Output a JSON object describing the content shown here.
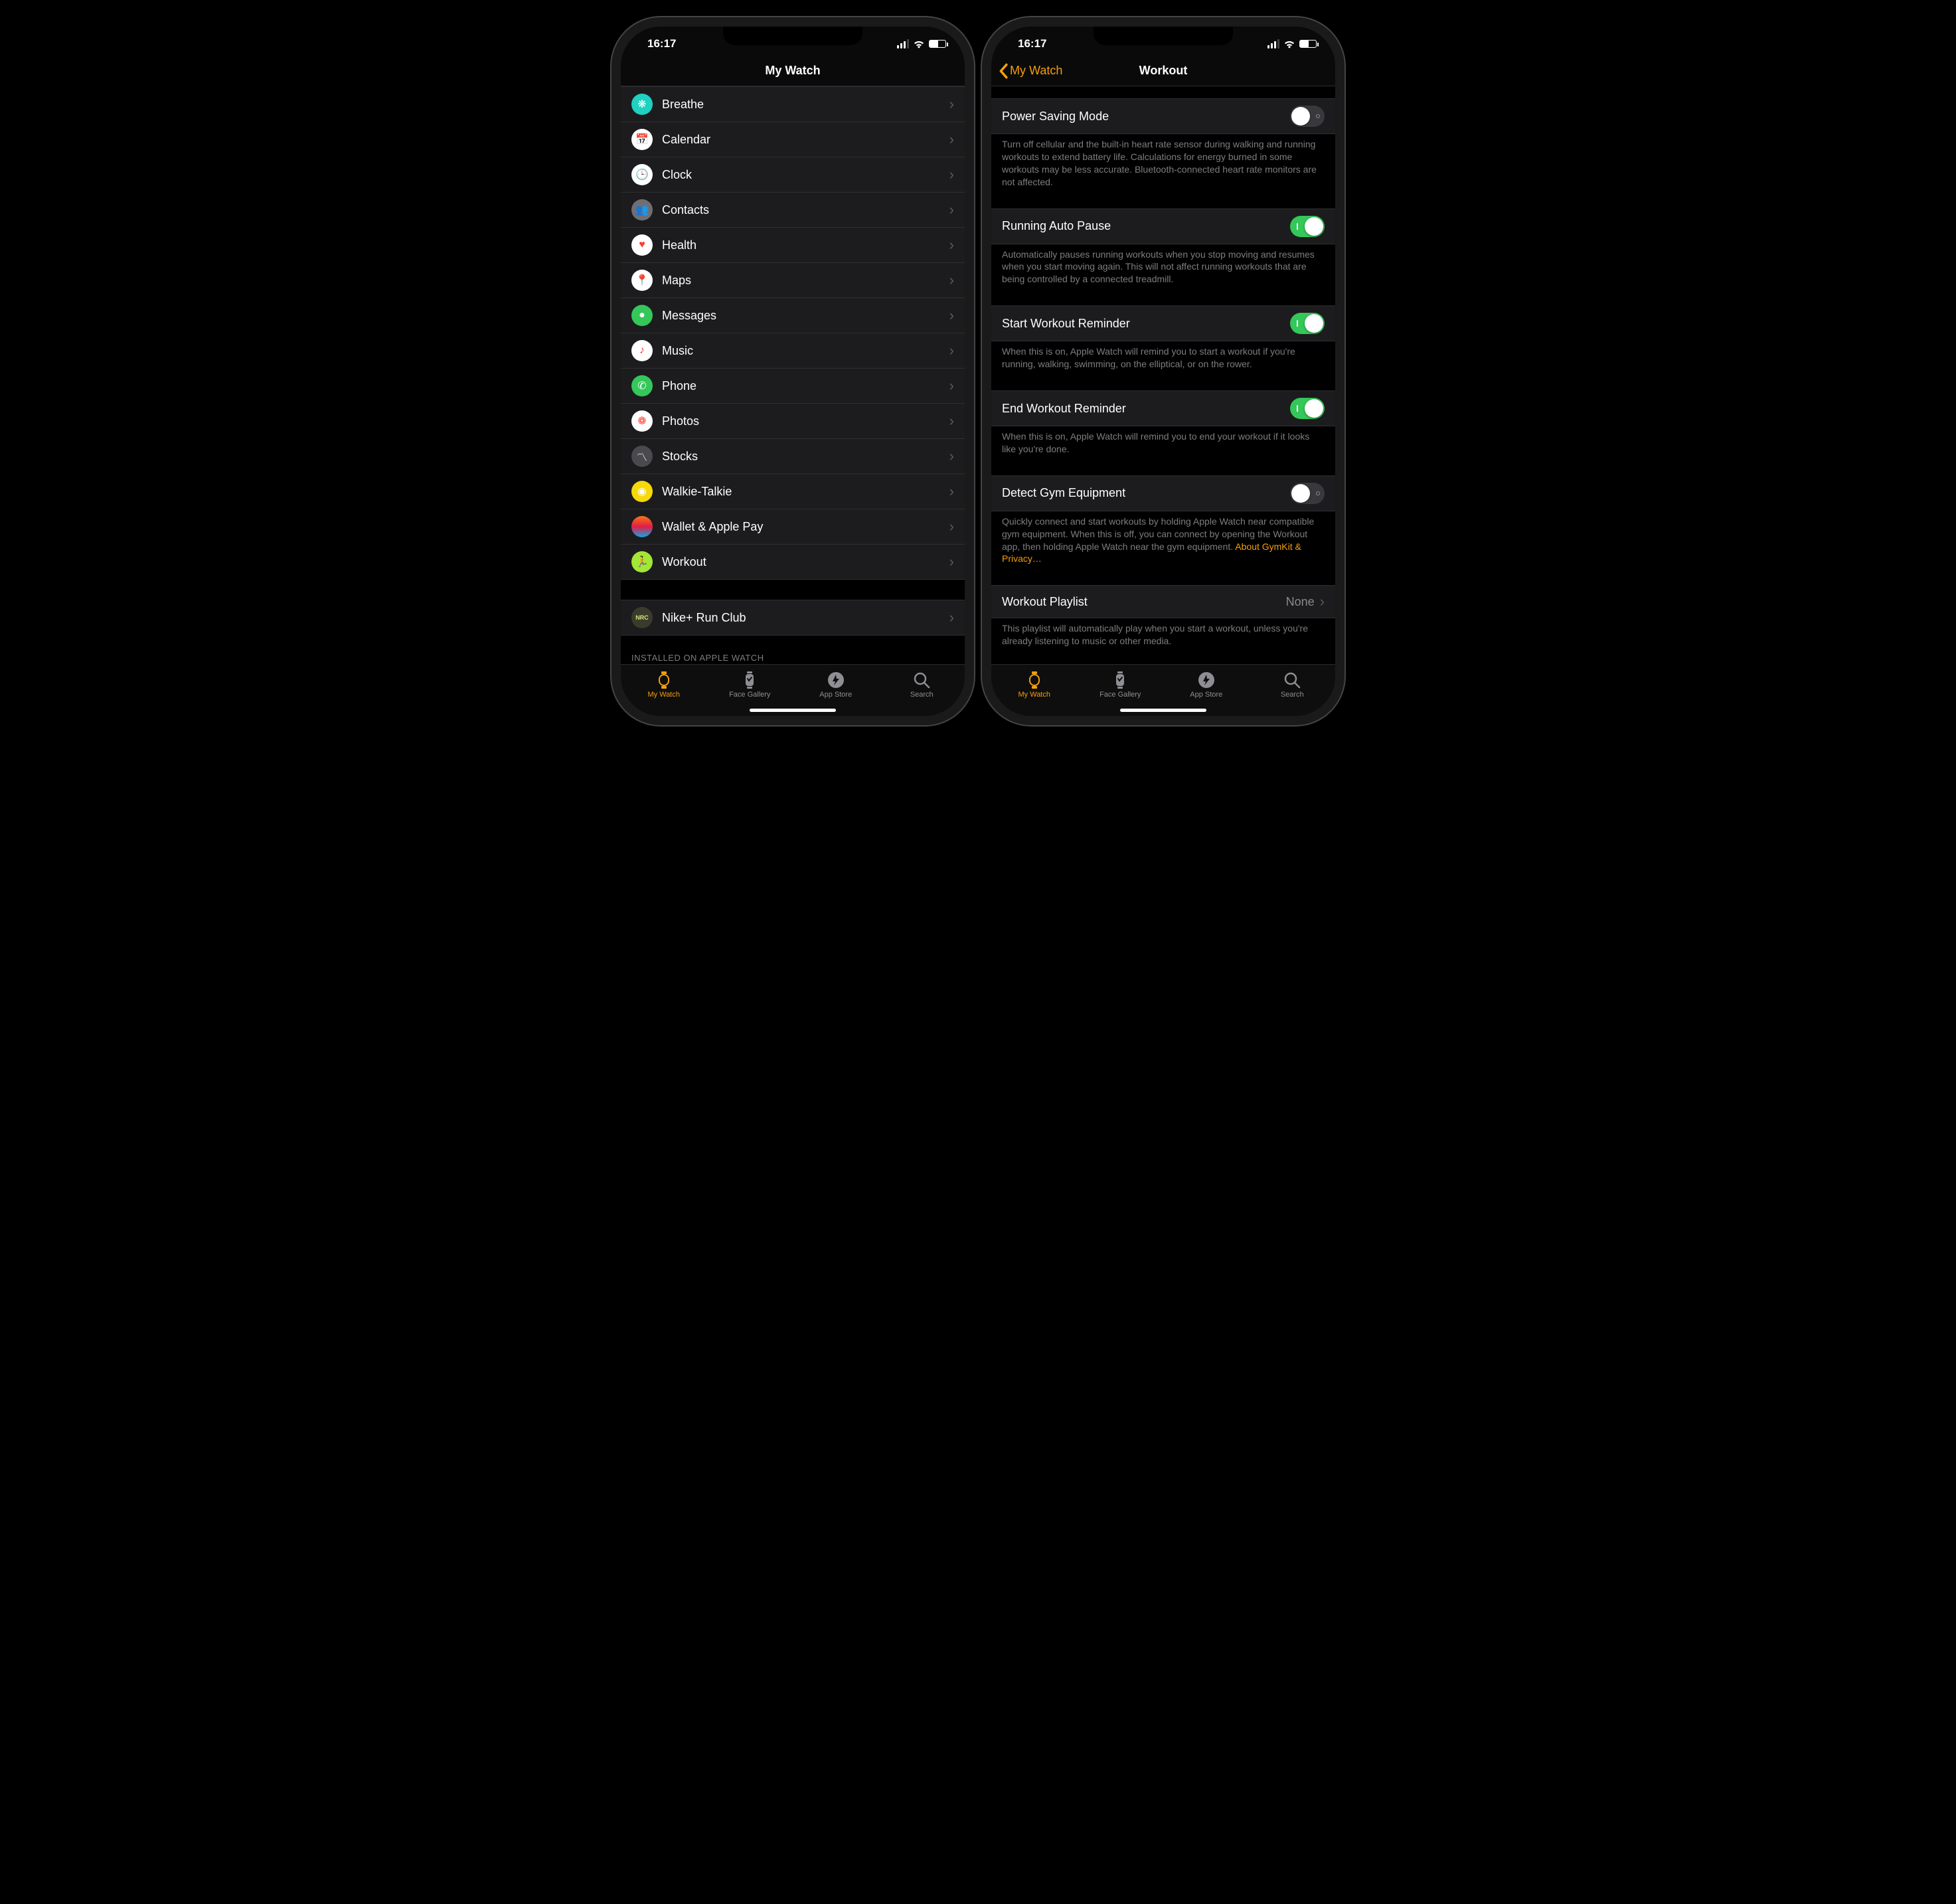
{
  "status": {
    "time": "16:17"
  },
  "accent": "#f59e0b",
  "tabs": {
    "items": [
      {
        "id": "my-watch",
        "label": "My Watch"
      },
      {
        "id": "face-gallery",
        "label": "Face Gallery"
      },
      {
        "id": "app-store",
        "label": "App Store"
      },
      {
        "id": "search",
        "label": "Search"
      }
    ],
    "active": "my-watch"
  },
  "left": {
    "title": "My Watch",
    "apps": [
      {
        "id": "breathe",
        "label": "Breathe",
        "color": "#1fd1c1",
        "glyph": "❋"
      },
      {
        "id": "calendar",
        "label": "Calendar",
        "color": "#ffffff",
        "glyph": "📅"
      },
      {
        "id": "clock",
        "label": "Clock",
        "color": "#ffffff",
        "glyph": "🕒"
      },
      {
        "id": "contacts",
        "label": "Contacts",
        "color": "#6f6f73",
        "glyph": "👥"
      },
      {
        "id": "health",
        "label": "Health",
        "color": "#ffffff",
        "glyph": "♥"
      },
      {
        "id": "maps",
        "label": "Maps",
        "color": "#ffffff",
        "glyph": "📍"
      },
      {
        "id": "messages",
        "label": "Messages",
        "color": "#34c759",
        "glyph": "●"
      },
      {
        "id": "music",
        "label": "Music",
        "color": "#ffffff",
        "glyph": "♪"
      },
      {
        "id": "phone",
        "label": "Phone",
        "color": "#34c759",
        "glyph": "✆"
      },
      {
        "id": "photos",
        "label": "Photos",
        "color": "#ffffff",
        "glyph": "❁"
      },
      {
        "id": "stocks",
        "label": "Stocks",
        "color": "#4a4a4e",
        "glyph": "〽"
      },
      {
        "id": "walkie",
        "label": "Walkie-Talkie",
        "color": "#f5d90a",
        "glyph": "◉"
      },
      {
        "id": "wallet",
        "label": "Wallet & Apple Pay",
        "color": "linear-gradient(#f97316,#e11d48,#0ea5e9)",
        "glyph": ""
      },
      {
        "id": "workout",
        "label": "Workout",
        "color": "#a3e635",
        "glyph": "🏃"
      }
    ],
    "third_party": [
      {
        "id": "nike-nrc",
        "label": "Nike+ Run Club",
        "color": "#3b3b2d",
        "glyph": "NRC"
      }
    ],
    "installed_caption": "INSTALLED ON APPLE WATCH"
  },
  "right": {
    "back": "My Watch",
    "title": "Workout",
    "settings": [
      {
        "id": "power-saving",
        "label": "Power Saving Mode",
        "on": false,
        "footer": "Turn off cellular and the built-in heart rate sensor during walking and running workouts to extend battery life. Calculations for energy burned in some workouts may be less accurate. Bluetooth-connected heart rate monitors are not affected."
      },
      {
        "id": "running-auto-pause",
        "label": "Running Auto Pause",
        "on": true,
        "footer": "Automatically pauses running workouts when you stop moving and resumes when you start moving again. This will not affect running workouts that are being controlled by a connected treadmill."
      },
      {
        "id": "start-workout-reminder",
        "label": "Start Workout Reminder",
        "on": true,
        "footer": "When this is on, Apple Watch will remind you to start a workout if you're running, walking, swimming, on the elliptical, or on the rower."
      },
      {
        "id": "end-workout-reminder",
        "label": "End Workout Reminder",
        "on": true,
        "footer": "When this is on, Apple Watch will remind you to end your workout if it looks like you're done."
      },
      {
        "id": "detect-gym-equipment",
        "label": "Detect Gym Equipment",
        "on": false,
        "footer": "Quickly connect and start workouts by holding Apple Watch near compatible gym equipment. When this is off, you can connect by opening the Workout app, then holding Apple Watch near the gym equipment.",
        "footer_link": "About GymKit & Privacy…"
      }
    ],
    "playlist": {
      "label": "Workout Playlist",
      "value": "None",
      "footer": "This playlist will automatically play when you start a workout, unless you're already listening to music or other media."
    }
  }
}
